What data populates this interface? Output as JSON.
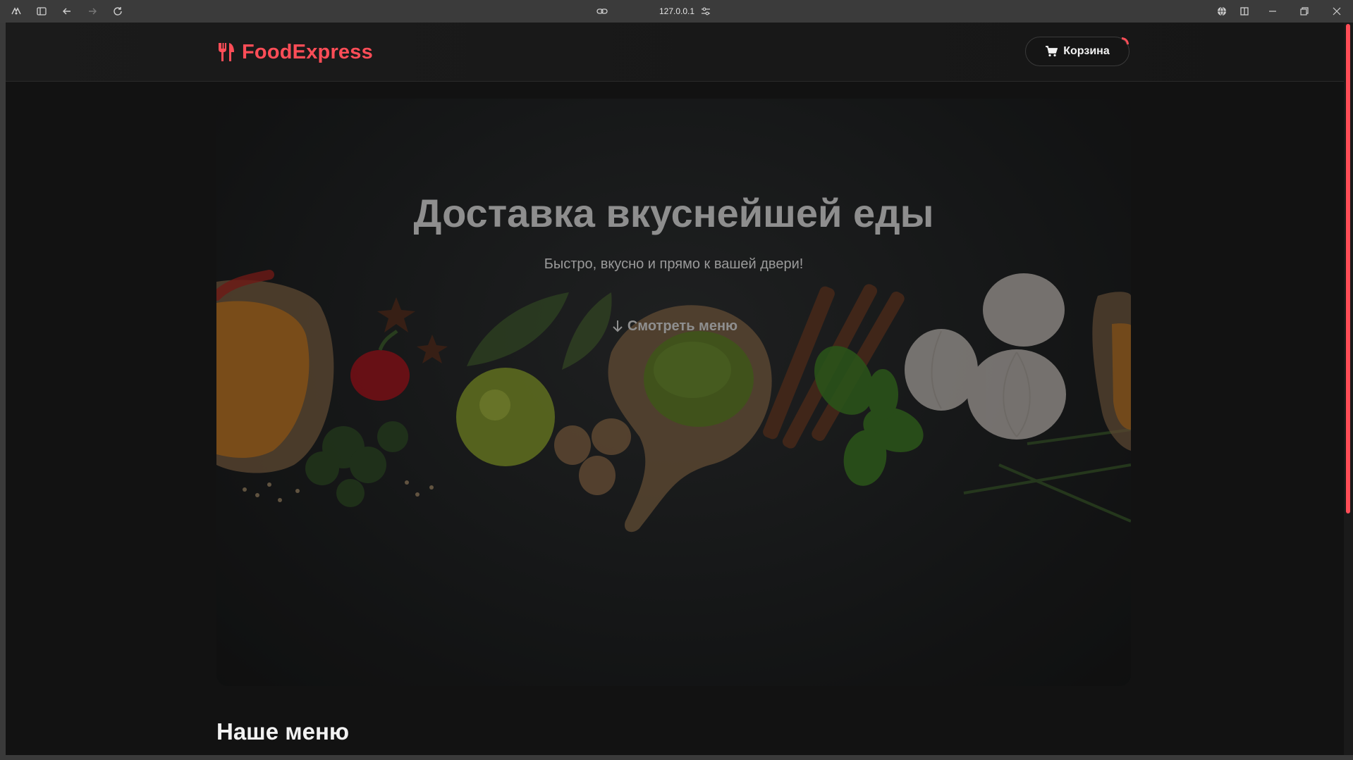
{
  "browser": {
    "address": "127.0.0.1"
  },
  "header": {
    "logo": "FoodExpress",
    "cart_label": "Корзина"
  },
  "hero": {
    "title": "Доставка вкуснейшей еды",
    "subtitle": "Быстро, вкусно и прямо к вашей двери!",
    "cta_label": "Смотреть меню"
  },
  "menu": {
    "title": "Наше меню"
  },
  "colors": {
    "accent": "#ff4d57",
    "background": "#121212"
  }
}
